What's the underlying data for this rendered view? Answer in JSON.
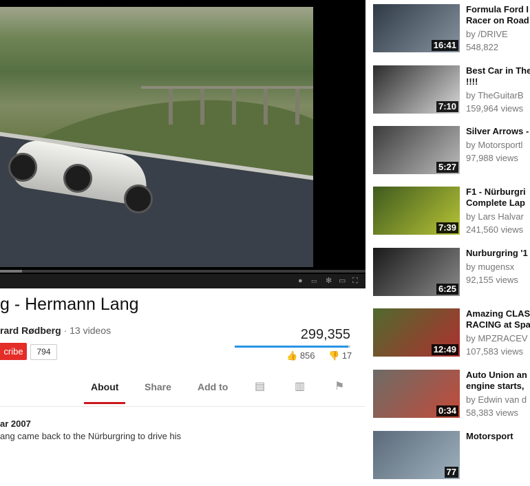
{
  "video": {
    "title": "g - Hermann Lang",
    "progress": 0.06
  },
  "player_controls": {
    "annotations_icon": "annotations-icon",
    "captions_icon": "captions-icon",
    "settings_icon": "gear-icon",
    "theater_icon": "theater-mode-icon",
    "fullscreen_icon": "fullscreen-icon"
  },
  "channel": {
    "name": "rard Rødberg",
    "separator": " · ",
    "video_count": "13 videos",
    "subscribe_label": "cribe",
    "subscriber_count": "794"
  },
  "stats": {
    "views": "299,355",
    "likes": "856",
    "dislikes": "17",
    "like_ratio": 0.98,
    "colors": {
      "like_bar": "#2793e6",
      "dislike_bar": "#cccccc",
      "subscribe": "#e52d27",
      "active_tab": "#cc181e"
    }
  },
  "tabs": [
    {
      "label": "About",
      "active": true
    },
    {
      "label": "Share",
      "active": false
    },
    {
      "label": "Add to",
      "active": false
    }
  ],
  "tab_icons": [
    "transcript-icon",
    "statistics-icon",
    "flag-icon"
  ],
  "description": {
    "published": "ar 2007",
    "text": "ang came back to the Nürburgring to drive his"
  },
  "related": [
    {
      "title1": "Formula Ford I",
      "title2": "Racer on Road",
      "channel": "by /DRIVE",
      "views": "548,822",
      "duration": "16:41",
      "palette": [
        "#2f3a46",
        "#8794a0"
      ]
    },
    {
      "title1": "Best Car in The",
      "title2": "!!!!",
      "channel": "by TheGuitarB",
      "views": "159,964 views",
      "duration": "7:10",
      "palette": [
        "#2c2c2c",
        "#d9d9d9"
      ]
    },
    {
      "title1": "Silver Arrows -",
      "title2": "",
      "channel": "by Motorsportl",
      "views": "97,988 views",
      "duration": "5:27",
      "palette": [
        "#3b3b3b",
        "#bdbdbd"
      ]
    },
    {
      "title1": "F1 - Nürburgri",
      "title2": "Complete Lap",
      "channel": "by Lars Halvar",
      "views": "241,560 views",
      "duration": "7:39",
      "palette": [
        "#3f5a1e",
        "#b7c436"
      ]
    },
    {
      "title1": "Nurburgring '1",
      "title2": "",
      "channel": "by mugensx",
      "views": "92,155 views",
      "duration": "6:25",
      "palette": [
        "#1a1a1a",
        "#8a8a8a"
      ]
    },
    {
      "title1": "Amazing CLAS",
      "title2": "RACING at Spa",
      "channel": "by MPZRACEV",
      "views": "107,583 views",
      "duration": "12:49",
      "palette": [
        "#4f6a2d",
        "#b03030"
      ]
    },
    {
      "title1": "Auto Union an",
      "title2": "engine starts,",
      "channel": "by Edwin van d",
      "views": "58,383 views",
      "duration": "0:34",
      "palette": [
        "#6c6c66",
        "#c44a3a"
      ]
    },
    {
      "title1": "Motorsport",
      "title2": "",
      "channel": "",
      "views": "",
      "duration": "77",
      "palette": [
        "#5a6a7a",
        "#9fb0bd"
      ]
    }
  ]
}
